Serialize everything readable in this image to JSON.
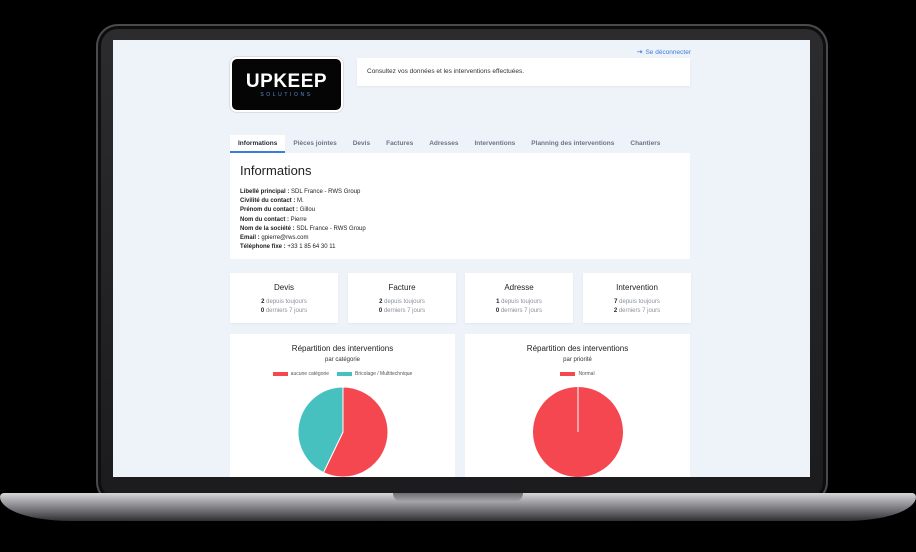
{
  "header": {
    "logo_main": "UPKEEP",
    "logo_sub": "SOLUTIONS",
    "logout_label": "Se déconnecter",
    "intro_text": "Consultez vos données et les interventions effectuées."
  },
  "tabs": [
    {
      "label": "Informations",
      "active": true
    },
    {
      "label": "Pièces jointes"
    },
    {
      "label": "Devis"
    },
    {
      "label": "Factures"
    },
    {
      "label": "Adresses"
    },
    {
      "label": "Interventions"
    },
    {
      "label": "Planning des interventions"
    },
    {
      "label": "Chantiers"
    }
  ],
  "info": {
    "title": "Informations",
    "rows": [
      {
        "label": "Libellé principal :",
        "value": "SDL France - RWS Group"
      },
      {
        "label": "Civilité du contact :",
        "value": "M."
      },
      {
        "label": "Prénom du contact :",
        "value": "Gillou"
      },
      {
        "label": "Nom du contact :",
        "value": "Pierre"
      },
      {
        "label": "Nom de la société :",
        "value": "SDL France - RWS Group"
      },
      {
        "label": "Email :",
        "value": "gpierre@rws.com"
      },
      {
        "label": "Téléphone fixe :",
        "value": "+33 1 85 64 30 11"
      }
    ]
  },
  "stats": [
    {
      "title": "Devis",
      "total": "2",
      "total_label": "depuis toujours",
      "recent": "0",
      "recent_label": "derniers 7 jours"
    },
    {
      "title": "Facture",
      "total": "2",
      "total_label": "depuis toujours",
      "recent": "0",
      "recent_label": "derniers 7 jours"
    },
    {
      "title": "Adresse",
      "total": "1",
      "total_label": "depuis toujours",
      "recent": "0",
      "recent_label": "derniers 7 jours"
    },
    {
      "title": "Intervention",
      "total": "7",
      "total_label": "depuis toujours",
      "recent": "2",
      "recent_label": "derniers 7 jours"
    }
  ],
  "colors": {
    "accent": "#3b7dd8",
    "red": "#f5474f",
    "teal": "#47c1bf"
  },
  "chart_data": [
    {
      "type": "pie",
      "title": "Répartition des interventions",
      "subtitle": "par catégorie",
      "categories": [
        "aucune catégorie",
        "Bricolage / Multitechnique"
      ],
      "values": [
        4,
        3
      ],
      "colors": [
        "#f5474f",
        "#47c1bf"
      ],
      "legend": "top"
    },
    {
      "type": "pie",
      "title": "Répartition des interventions",
      "subtitle": "par priorité",
      "categories": [
        "Normal"
      ],
      "values": [
        7
      ],
      "colors": [
        "#f5474f"
      ],
      "legend": "top"
    }
  ]
}
